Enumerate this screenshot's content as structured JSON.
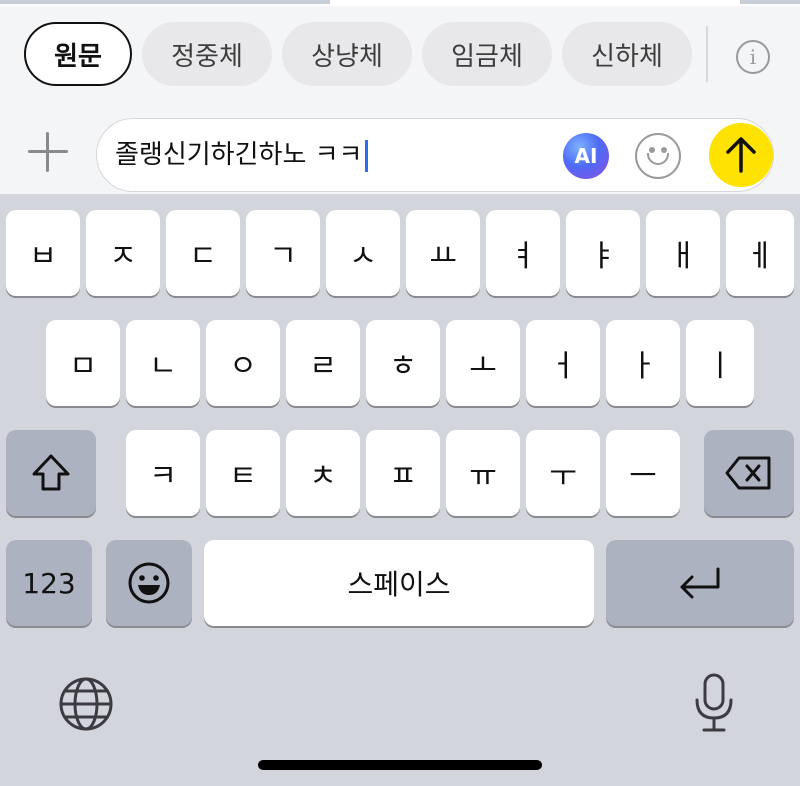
{
  "style_chips": {
    "items": [
      {
        "label": "원문",
        "selected": true
      },
      {
        "label": "정중체",
        "selected": false
      },
      {
        "label": "상냥체",
        "selected": false
      },
      {
        "label": "임금체",
        "selected": false
      },
      {
        "label": "신하체",
        "selected": false
      }
    ],
    "info_glyph": "i"
  },
  "composer": {
    "message_text": "졸랭신기하긴하노 ㅋㅋ",
    "ai_label": "AI",
    "send_color": "#fde202"
  },
  "keyboard": {
    "row1": [
      "ㅂ",
      "ㅈ",
      "ㄷ",
      "ㄱ",
      "ㅅ",
      "ㅛ",
      "ㅕ",
      "ㅑ",
      "ㅐ",
      "ㅔ"
    ],
    "row2": [
      "ㅁ",
      "ㄴ",
      "ㅇ",
      "ㄹ",
      "ㅎ",
      "ㅗ",
      "ㅓ",
      "ㅏ",
      "ㅣ"
    ],
    "row3": [
      "ㅋ",
      "ㅌ",
      "ㅊ",
      "ㅍ",
      "ㅠ",
      "ㅜ",
      "ㅡ"
    ],
    "numbers_label": "123",
    "space_label": "스페이스"
  },
  "icons": {
    "plus": "plus-icon",
    "info": "info-icon",
    "ai": "ai-icon",
    "emoji": "emoji-icon",
    "send": "arrow-up-icon",
    "shift": "shift-icon",
    "backspace": "backspace-icon",
    "keyboard_emoji": "emoji-icon",
    "return": "return-icon",
    "globe": "globe-icon",
    "mic": "microphone-icon"
  }
}
